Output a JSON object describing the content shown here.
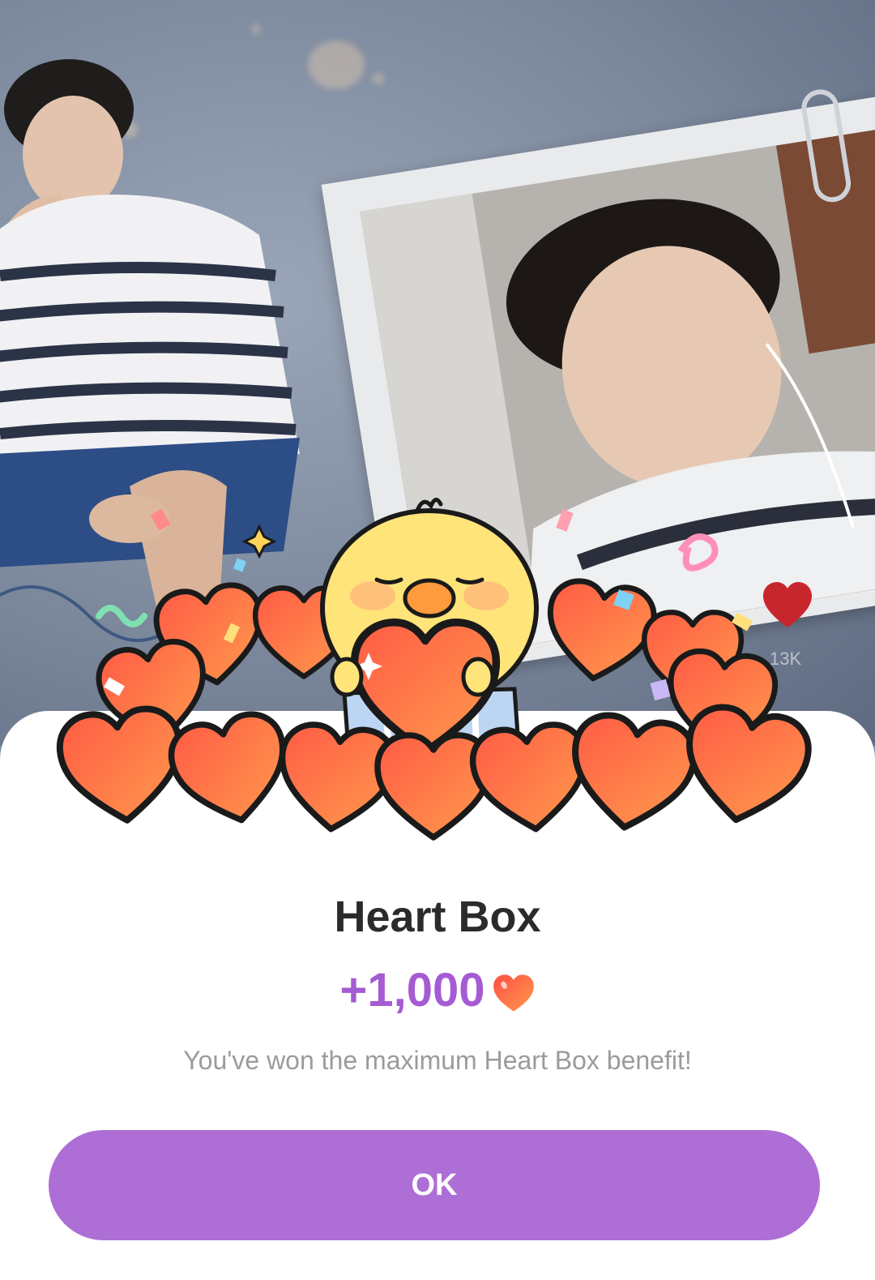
{
  "background": {
    "reaction_count": "13K"
  },
  "dialog": {
    "title": "Heart Box",
    "amount": "+1,000",
    "amount_icon": "heart-icon",
    "message": "You've won the maximum Heart Box benefit!",
    "ok_label": "OK"
  },
  "colors": {
    "accent_purple": "#ad6ed5",
    "amount_purple": "#a55bd3",
    "heart_red": "#f0583f",
    "heart_orange": "#ff8a4c",
    "chick_yellow": "#ffe47a"
  }
}
